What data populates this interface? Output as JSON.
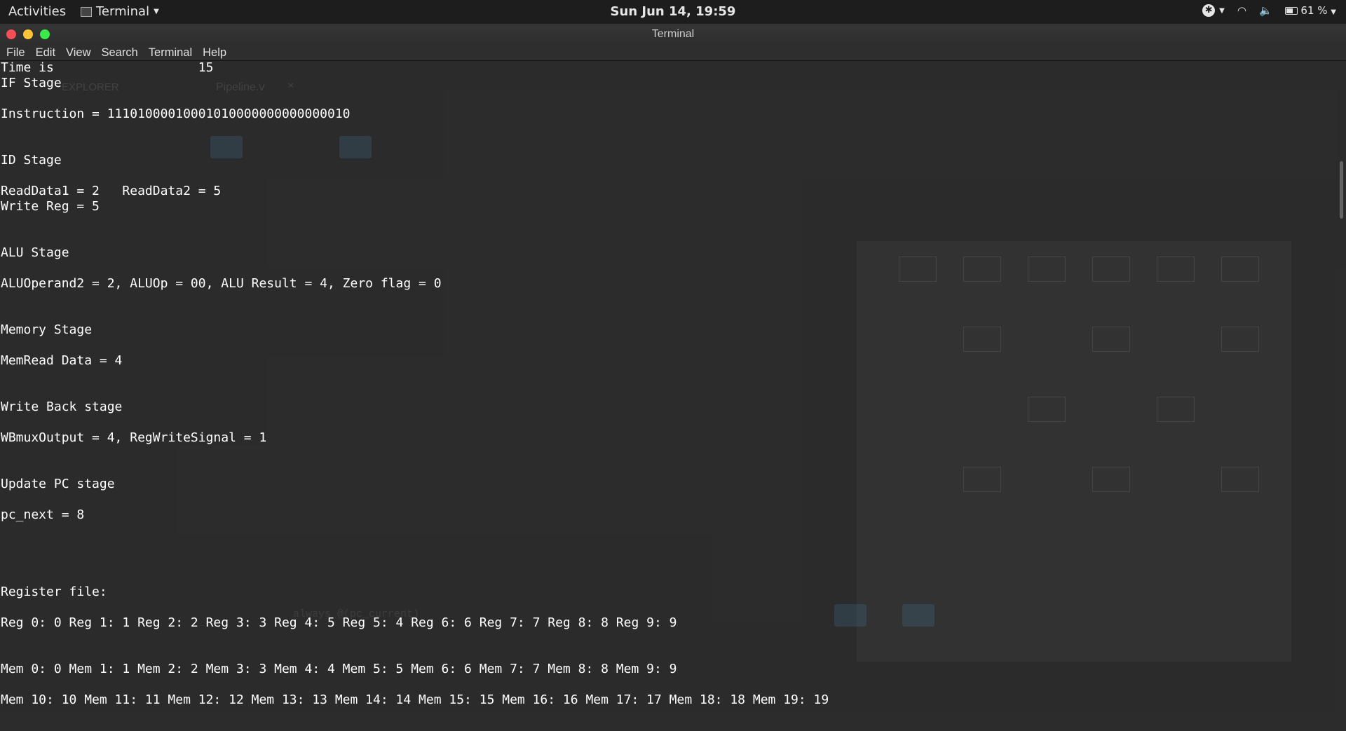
{
  "topbar": {
    "activities": "Activities",
    "app_name": "Terminal",
    "clock": "Sun Jun 14, 19:59",
    "battery": "61 %"
  },
  "window": {
    "title": "Terminal"
  },
  "menu": {
    "items": [
      "File",
      "Edit",
      "View",
      "Search",
      "Terminal",
      "Help"
    ]
  },
  "terminal": {
    "lines": [
      "Time is                   15",
      "IF Stage",
      "",
      "Instruction = 11101000010001010000000000000010",
      "",
      "",
      "ID Stage",
      "",
      "ReadData1 = 2   ReadData2 = 5",
      "Write Reg = 5",
      "",
      "",
      "ALU Stage",
      "",
      "ALUOperand2 = 2, ALUOp = 00, ALU Result = 4, Zero flag = 0",
      "",
      "",
      "Memory Stage",
      "",
      "MemRead Data = 4",
      "",
      "",
      "Write Back stage",
      "",
      "WBmuxOutput = 4, RegWriteSignal = 1",
      "",
      "",
      "Update PC stage",
      "",
      "pc_next = 8",
      "",
      "",
      "",
      "",
      "Register file:",
      "",
      "Reg 0: 0 Reg 1: 1 Reg 2: 2 Reg 3: 3 Reg 4: 5 Reg 5: 4 Reg 6: 6 Reg 7: 7 Reg 8: 8 Reg 9: 9",
      "",
      "",
      "Mem 0: 0 Mem 1: 1 Mem 2: 2 Mem 3: 3 Mem 4: 4 Mem 5: 5 Mem 6: 6 Mem 7: 7 Mem 8: 8 Mem 9: 9",
      "",
      "Mem 10: 10 Mem 11: 11 Mem 12: 12 Mem 13: 13 Mem 14: 14 Mem 15: 15 Mem 16: 16 Mem 17: 17 Mem 18: 18 Mem 19: 19"
    ]
  },
  "background": {
    "explorer_label": "EXPLORER",
    "editor_tab": "Pipeline.v",
    "code_snippet": "always @(pc_current)"
  }
}
